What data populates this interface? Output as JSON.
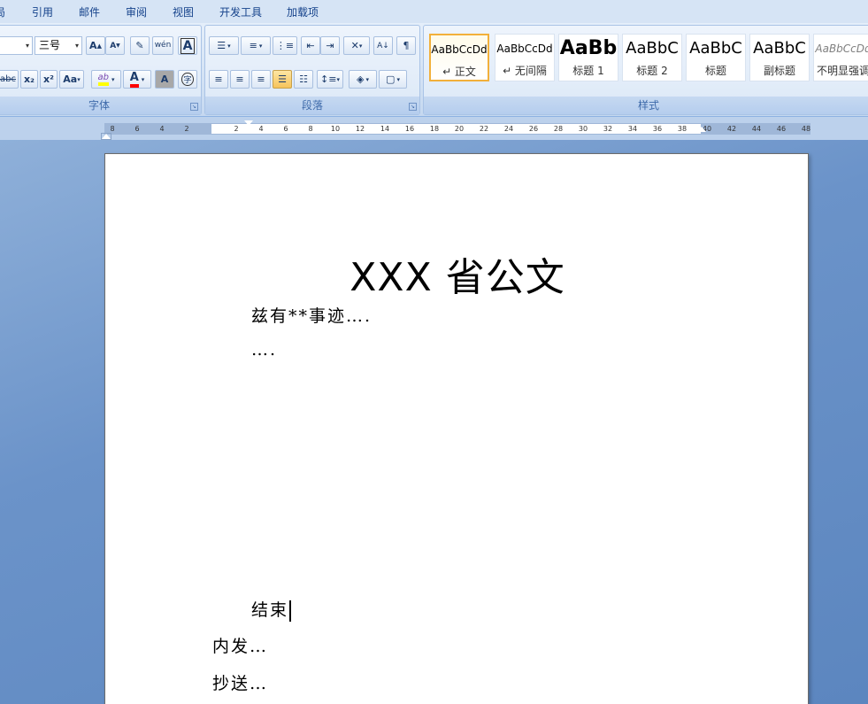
{
  "menu": {
    "tabs": [
      "局",
      "引用",
      "邮件",
      "审阅",
      "视图",
      "开发工具",
      "加载项"
    ]
  },
  "ribbon": {
    "font_group": {
      "label": "字体",
      "size_value": "三号",
      "grow_font": "A",
      "shrink_font": "A",
      "change_case": "Aa",
      "highlight": "ab",
      "font_color": "A",
      "char_shading": "A",
      "enclose": "字",
      "strikethrough": "abc",
      "subscript": "x₂",
      "superscript": "x²",
      "phonetic": "wén",
      "border_char": "A"
    },
    "paragraph_group": {
      "label": "段落"
    },
    "styles_group": {
      "label": "样式",
      "items": [
        {
          "sample": "AaBbCcDd",
          "name": "↵ 正文"
        },
        {
          "sample": "AaBbCcDd",
          "name": "↵ 无间隔"
        },
        {
          "sample": "AaBb",
          "name": "标题 1"
        },
        {
          "sample": "AaBbC",
          "name": "标题 2"
        },
        {
          "sample": "AaBbC",
          "name": "标题"
        },
        {
          "sample": "AaBbC",
          "name": "副标题"
        },
        {
          "sample": "AaBbCcDd",
          "name": "不明显强调"
        }
      ]
    }
  },
  "ruler": {
    "numbers": [
      "8",
      "6",
      "4",
      "2",
      "",
      "2",
      "4",
      "6",
      "8",
      "10",
      "12",
      "14",
      "16",
      "18",
      "20",
      "22",
      "24",
      "26",
      "28",
      "30",
      "32",
      "34",
      "36",
      "38",
      "40",
      "42",
      "44",
      "46",
      "48"
    ]
  },
  "document": {
    "title": "XXX 省公文",
    "line1": "兹有**事迹….",
    "line2": "….",
    "closing": "结束",
    "internal": "内发…",
    "cc": "抄送…"
  },
  "colors": {
    "accent": "#15428b",
    "highlight_yellow": "#ffff00",
    "font_color_red": "#ff0000",
    "selected_style_border": "#f2b03a"
  }
}
